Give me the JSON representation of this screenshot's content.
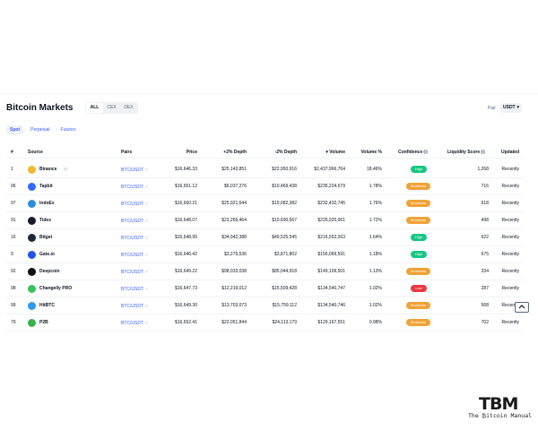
{
  "header": {
    "title": "Bitcoin Markets",
    "segments": [
      "ALL",
      "CEX",
      "DEX"
    ],
    "pair_label": "Pair",
    "pair_value": "USDT"
  },
  "subtabs": [
    "Spot",
    "Perpetual",
    "Futures"
  ],
  "columns": {
    "rank": "#",
    "source": "Source",
    "pairs": "Pairs",
    "price": "Price",
    "depth_plus": "+2% Depth",
    "depth_minus": "-2% Depth",
    "volume": "Volume",
    "volume_pct": "Volume %",
    "confidence": "Confidence",
    "liquidity": "Liquidity Score",
    "updated": "Updated"
  },
  "rows": [
    {
      "rank": "1",
      "source": "Binance",
      "pair": "BTC/USDT",
      "price": "$16,646.33",
      "depth_plus": "$25,143,851",
      "depth_minus": "$22,950,916",
      "volume": "$2,437,966,764",
      "volume_pct": "18.46%",
      "confidence": "High",
      "liquidity": "1,268",
      "updated": "Recently"
    },
    {
      "rank": "96",
      "source": "Tapbit",
      "pair": "BTC/USDT",
      "price": "$16,651.12",
      "depth_plus": "$6,037,276",
      "depth_minus": "$10,469,438",
      "volume": "$235,224,679",
      "volume_pct": "1.78%",
      "confidence": "Moderate",
      "liquidity": "716",
      "updated": "Recently"
    },
    {
      "rank": "97",
      "source": "IndoEx",
      "pair": "BTC/USDT",
      "price": "$16,660.21",
      "depth_plus": "$25,921,644",
      "depth_minus": "$19,082,382",
      "volume": "$232,432,745",
      "volume_pct": "1.76%",
      "confidence": "Moderate",
      "liquidity": "618",
      "updated": "Recently"
    },
    {
      "rank": "91",
      "source": "Tidex",
      "pair": "BTC/USDT",
      "price": "$16,648.07",
      "depth_plus": "$23,266,464",
      "depth_minus": "$10,690,567",
      "volume": "$226,925,061",
      "volume_pct": "1.72%",
      "confidence": "Moderate",
      "liquidity": "498",
      "updated": "Recently"
    },
    {
      "rank": "16",
      "source": "Bitget",
      "pair": "BTC/USDT",
      "price": "$16,648.95",
      "depth_plus": "$34,942,388",
      "depth_minus": "$49,525,545",
      "volume": "$216,552,263",
      "volume_pct": "1.64%",
      "confidence": "High",
      "liquidity": "622",
      "updated": "Recently"
    },
    {
      "rank": "9",
      "source": "Gate.io",
      "pair": "BTC/USDT",
      "price": "$16,646.42",
      "depth_plus": "$3,279,536",
      "depth_minus": "$3,871,802",
      "volume": "$156,069,591",
      "volume_pct": "1.18%",
      "confidence": "High",
      "liquidity": "675",
      "updated": "Recently"
    },
    {
      "rank": "92",
      "source": "Deepcoin",
      "pair": "BTC/USDT",
      "price": "$16,649.22",
      "depth_plus": "$98,033,038",
      "depth_minus": "$85,044,918",
      "volume": "$149,109,501",
      "volume_pct": "1.13%",
      "confidence": "Moderate",
      "liquidity": "334",
      "updated": "Recently"
    },
    {
      "rank": "98",
      "source": "Changelly PRO",
      "pair": "BTC/USDT",
      "price": "$16,647.73",
      "depth_plus": "$12,219,012",
      "depth_minus": "$15,509,428",
      "volume": "$134,540,747",
      "volume_pct": "1.02%",
      "confidence": "Low",
      "liquidity": "287",
      "updated": "Recently"
    },
    {
      "rank": "99",
      "source": "HitBTC",
      "pair": "BTC/USDT",
      "price": "$16,649.30",
      "depth_plus": "$13,703,073",
      "depth_minus": "$15,759,112",
      "volume": "$134,540,746",
      "volume_pct": "1.02%",
      "confidence": "Moderate",
      "liquidity": "568",
      "updated": "Recently"
    },
    {
      "rank": "79",
      "source": "P2B",
      "pair": "BTC/USDT",
      "price": "$16,652.41",
      "depth_plus": "$22,051,844",
      "depth_minus": "$24,113,179",
      "volume": "$129,167,551",
      "volume_pct": "0.98%",
      "confidence": "Moderate",
      "liquidity": "702",
      "updated": "Recently"
    }
  ],
  "logo_colors": [
    "#f3ba2f",
    "#2f6bff",
    "#2b8fd9",
    "#1a1a2e",
    "#1b2a3a",
    "#2354e6",
    "#111111",
    "#37c35a",
    "#2b9af3",
    "#37b24d"
  ],
  "confidence_colors": {
    "High": "#16c784",
    "Moderate": "#f0a236",
    "Low": "#ea3943"
  },
  "watermark": {
    "big": "TBM",
    "small": "The ₿itcoin Manual"
  }
}
